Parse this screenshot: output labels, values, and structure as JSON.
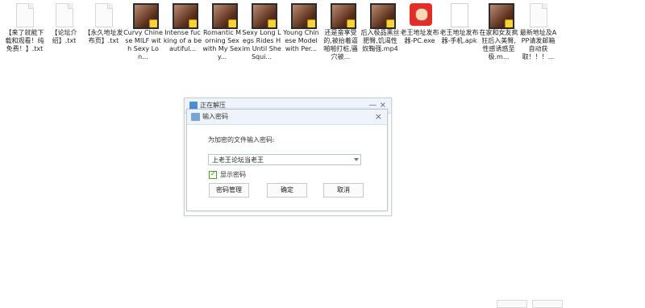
{
  "desktop_files": [
    {
      "label": "【来了就能下载和观看！纯免费！】.txt",
      "type": "txt"
    },
    {
      "label": "【论坛介绍】.txt",
      "type": "txt"
    },
    {
      "label": "【永久地址发布页】.txt",
      "type": "txt"
    },
    {
      "label": "Curvy Chinese MILF with Sexy Lon...",
      "type": "video"
    },
    {
      "label": "Intense fucking of a beautiful...",
      "type": "video"
    },
    {
      "label": "Romantic Morning Sex with My Sexy...",
      "type": "video"
    },
    {
      "label": "Sexy Long Legs Rides Him Until She Squi...",
      "type": "video"
    },
    {
      "label": "Young Chinese Model with Per...",
      "type": "video"
    },
    {
      "label": "还是蛮享受的,被抬着逼啪啪打桩,骚穴被...",
      "type": "video"
    },
    {
      "label": "后入极品黑丝肥臀,饥渴性奴鞠强.mp4",
      "type": "video"
    },
    {
      "label": "老王地址发布器-PC.exe",
      "type": "app"
    },
    {
      "label": "老王地址发布器-手机.apk",
      "type": "apk"
    },
    {
      "label": "在家和女友疯狂后入美臀,性感诱惑至极.m...",
      "type": "video"
    },
    {
      "label": "最新地址及APP请发邮箱自动获取！！！...",
      "type": "txt"
    }
  ],
  "background_dialog": {
    "title": "正在解压",
    "minimize": "—",
    "close": "×"
  },
  "password_dialog": {
    "title": "输入密码",
    "close": "×",
    "prompt": "为加密的文件输入密码:",
    "password_value": "上老王论坛当老王",
    "show_password_label": "显示密码",
    "buttons": {
      "manage": "密码管理",
      "ok": "确定",
      "cancel": "取消"
    }
  }
}
